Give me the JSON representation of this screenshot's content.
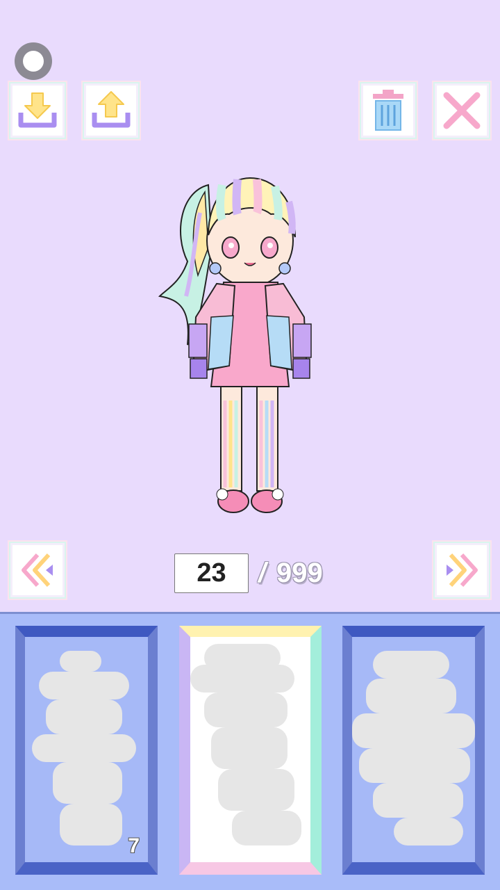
{
  "toolbar": {
    "status_icon": "status-circle-icon",
    "download_icon": "download-icon",
    "upload_icon": "upload-icon",
    "trash_icon": "trash-icon",
    "close_icon": "close-x-icon"
  },
  "navigation": {
    "prev_icon": "double-chevron-left-icon",
    "next_icon": "double-chevron-right-icon",
    "current_page": "23",
    "separator": "/",
    "total_pages": "999"
  },
  "slots": [
    {
      "number": "7",
      "selected": false
    },
    {
      "number": "",
      "selected": true
    },
    {
      "number": "",
      "selected": false
    }
  ],
  "colors": {
    "background": "#e9dbfd",
    "tray": "#a9bcf9",
    "slot_frame": "#3f59c1",
    "accent_pink": "#f7b6d4",
    "accent_yellow": "#ffe48a",
    "accent_purple": "#b79cf0"
  }
}
